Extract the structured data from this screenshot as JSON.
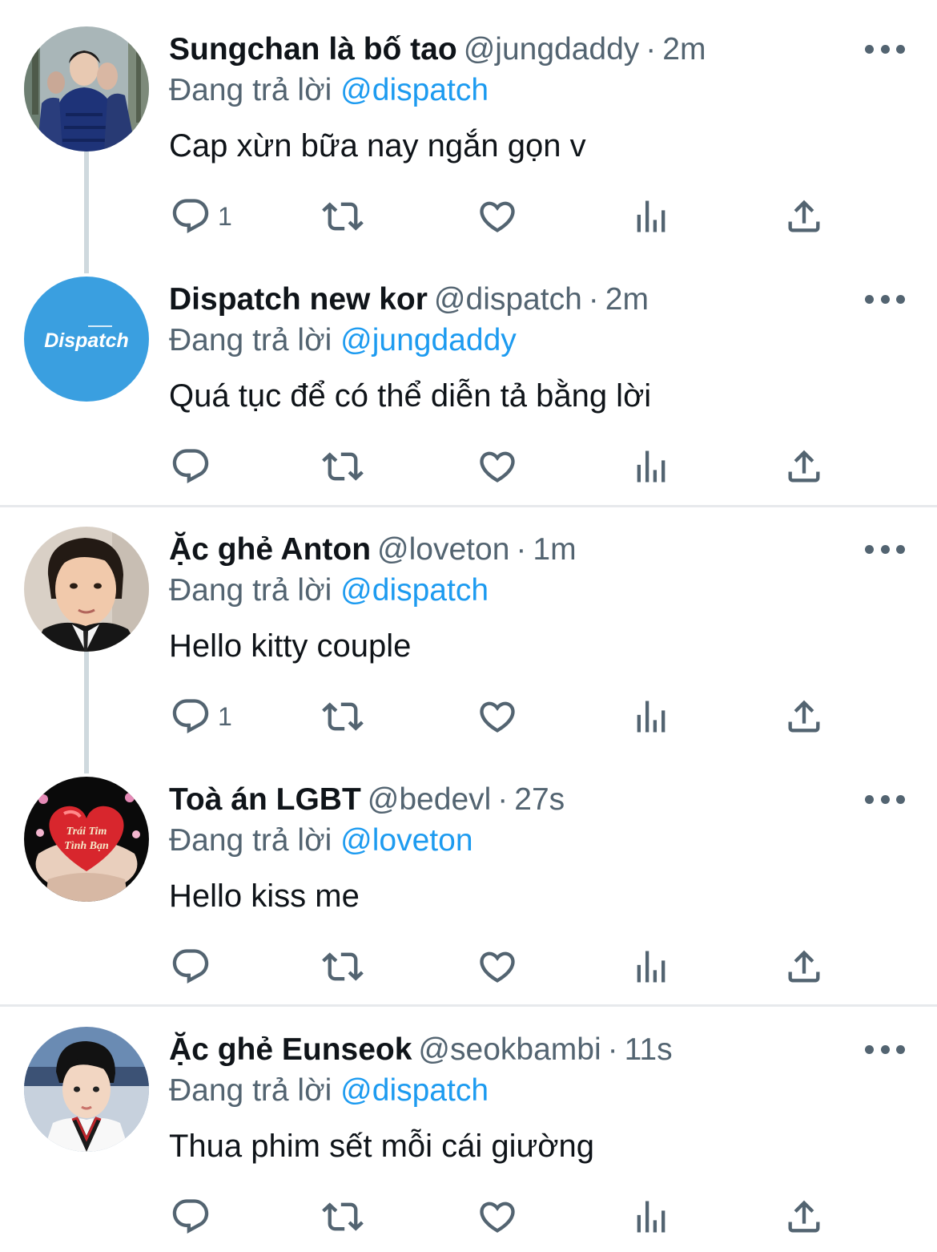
{
  "reply_prefix": "Đang trả lời",
  "colors": {
    "accent": "#1d9bf0",
    "secondary_text": "#536471",
    "primary_text": "#0f1419",
    "divider": "#e7e9ec"
  },
  "tweets": [
    {
      "name": "Sungchan là bố tao",
      "handle": "@jungdaddy",
      "time": "2m",
      "reply_to": "@dispatch",
      "text": "Cap xừn bữa nay ngắn gọn v",
      "reply_count": "1",
      "avatar": "photo-boy-puffer-jacket"
    },
    {
      "name": "Dispatch new kor",
      "handle": "@dispatch",
      "time": "2m",
      "reply_to": "@jungdaddy",
      "text": "Quá tục để có thể diễn tả bằng lời",
      "reply_count": "",
      "avatar": "dispatch-logo",
      "avatar_logo_text": "Dispatch"
    },
    {
      "name": "Ặc ghẻ Anton",
      "handle": "@loveton",
      "time": "1m",
      "reply_to": "@dispatch",
      "text": "Hello kitty couple",
      "reply_count": "1",
      "avatar": "photo-boy-suit"
    },
    {
      "name": "Toà án LGBT",
      "handle": "@bedevl",
      "time": "27s",
      "reply_to": "@loveton",
      "text": "Hello kiss me",
      "reply_count": "",
      "avatar": "heart-hands-image",
      "avatar_logo_text": "Trái Tim Tình Bạn"
    },
    {
      "name": "Ặc ghẻ Eunseok",
      "handle": "@seokbambi",
      "time": "11s",
      "reply_to": "@dispatch",
      "text": "Thua phim sết mỗi cái giường",
      "reply_count": "",
      "avatar": "photo-child-taekwondo"
    }
  ]
}
